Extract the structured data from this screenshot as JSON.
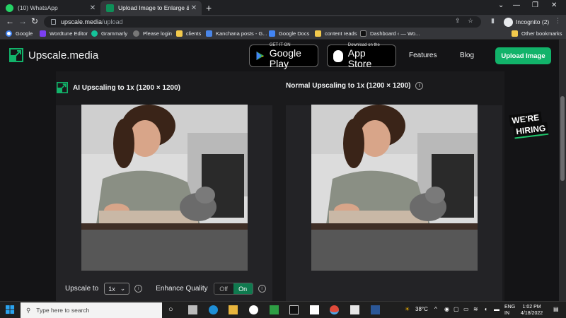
{
  "browser": {
    "tabs": [
      {
        "title": "(10) WhatsApp",
        "icon": "whatsapp-icon",
        "active": false
      },
      {
        "title": "Upload Image to Enlarge & Enha",
        "icon": "upscale-icon",
        "active": true
      }
    ],
    "url_host": "upscale.media",
    "url_path": "/upload",
    "profile_label": "Incognito (2)",
    "bookmarks": [
      {
        "label": "Google",
        "icon": "google-icon"
      },
      {
        "label": "Wordtune Editor",
        "icon": "wordtune-icon"
      },
      {
        "label": "Grammarly",
        "icon": "grammarly-icon"
      },
      {
        "label": "Please login",
        "icon": "globe-icon"
      },
      {
        "label": "clients",
        "icon": "folder-icon"
      },
      {
        "label": "Kanchana posts - G...",
        "icon": "sheets-icon"
      },
      {
        "label": "Google Docs",
        "icon": "docs-icon"
      },
      {
        "label": "content reads",
        "icon": "folder-icon"
      },
      {
        "label": "Dashboard ‹ — Wo...",
        "icon": "dashboard-icon"
      },
      {
        "label": "Other bookmarks",
        "icon": "folder-icon"
      }
    ]
  },
  "site": {
    "logo_text": "Upscale.media",
    "google_play": {
      "sub": "GET IT ON",
      "main": "Google Play"
    },
    "app_store": {
      "sub": "Download on the",
      "main": "App Store"
    },
    "nav": {
      "features": "Features",
      "blog": "Blog",
      "upload": "Upload Image"
    },
    "hiring": {
      "line1": "WE'RE",
      "line2": "HIRING"
    },
    "ai_title": "AI Upscaling to 1x (1200 × 1200)",
    "normal_title": "Normal Upscaling to 1x (1200 × 1200)",
    "upscale_label": "Upscale to",
    "upscale_value": "1x",
    "enhance_label": "Enhance Quality",
    "toggle_off": "Off",
    "toggle_on": "On"
  },
  "taskbar": {
    "search_placeholder": "Type here to search",
    "temperature": "38°C",
    "lang1": "ENG",
    "lang2": "IN",
    "time": "1:02 PM",
    "date": "4/18/2022"
  },
  "colors": {
    "accent": "#12b36a",
    "page_bg": "#141416",
    "image_placeholder": "#575757"
  }
}
